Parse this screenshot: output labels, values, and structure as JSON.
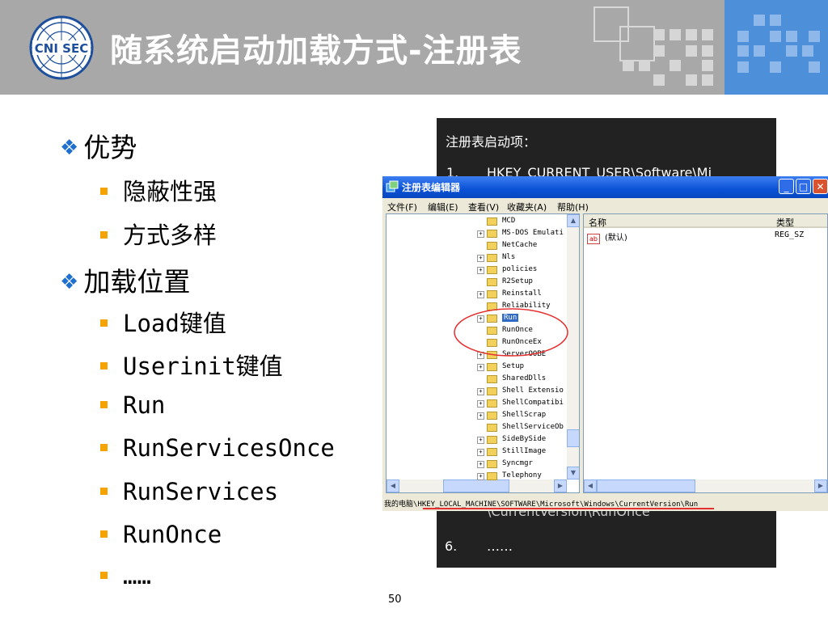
{
  "header": {
    "title": "随系统启动加载方式-注册表",
    "logo_text": "CNI SEC"
  },
  "bullets": {
    "advantages": "优势",
    "adv_items": [
      "隐蔽性强",
      "方式多样"
    ],
    "locations": "加载位置",
    "loc_items": [
      "Load键值",
      "Userinit键值",
      "Run",
      "RunServicesOnce",
      "RunServices",
      "RunOnce",
      "……"
    ]
  },
  "dark_panel": {
    "heading": "注册表启动项：",
    "item1_num": "1.",
    "item1_text": "HKEY_CURRENT_USER\\Software\\Mi",
    "item5_tail": "\\CurrentVersion\\RunOnce",
    "item6_num": "6.",
    "item6_text": "……"
  },
  "regedit": {
    "title": "注册表编辑器",
    "menu": [
      "文件(F)",
      "编辑(E)",
      "查看(V)",
      "收藏夹(A)",
      "帮助(H)"
    ],
    "tree": [
      {
        "name": "MCD",
        "expand": false
      },
      {
        "name": "MS-DOS Emulati",
        "expand": true
      },
      {
        "name": "NetCache",
        "expand": false
      },
      {
        "name": "Nls",
        "expand": true
      },
      {
        "name": "policies",
        "expand": true
      },
      {
        "name": "R2Setup",
        "expand": false
      },
      {
        "name": "Reinstall",
        "expand": true
      },
      {
        "name": "Reliability",
        "expand": false
      },
      {
        "name": "Run",
        "expand": true,
        "selected": true
      },
      {
        "name": "RunOnce",
        "expand": false
      },
      {
        "name": "RunOnceEx",
        "expand": false
      },
      {
        "name": "ServerOOBE",
        "expand": true
      },
      {
        "name": "Setup",
        "expand": true
      },
      {
        "name": "SharedDlls",
        "expand": false
      },
      {
        "name": "Shell Extensio",
        "expand": true
      },
      {
        "name": "ShellCompatibi",
        "expand": true
      },
      {
        "name": "ShellScrap",
        "expand": true
      },
      {
        "name": "ShellServiceOb",
        "expand": false
      },
      {
        "name": "SideBySide",
        "expand": true
      },
      {
        "name": "StillImage",
        "expand": true
      },
      {
        "name": "Syncmgr",
        "expand": true
      },
      {
        "name": "Telephony",
        "expand": true
      }
    ],
    "columns": [
      "名称",
      "类型"
    ],
    "value_name": "(默认)",
    "value_type": "REG_SZ",
    "value_icon": "ab",
    "status_path": "我的电脑\\HKEY_LOCAL_MACHINE\\SOFTWARE\\Microsoft\\Windows\\CurrentVersion\\Run",
    "minimize": "_",
    "maximize": "□",
    "close": "✕"
  },
  "page_number": "50",
  "colors": {
    "accent": "#1f6fcf",
    "bullet": "#f5a300",
    "highlight_circle": "#e53030"
  }
}
